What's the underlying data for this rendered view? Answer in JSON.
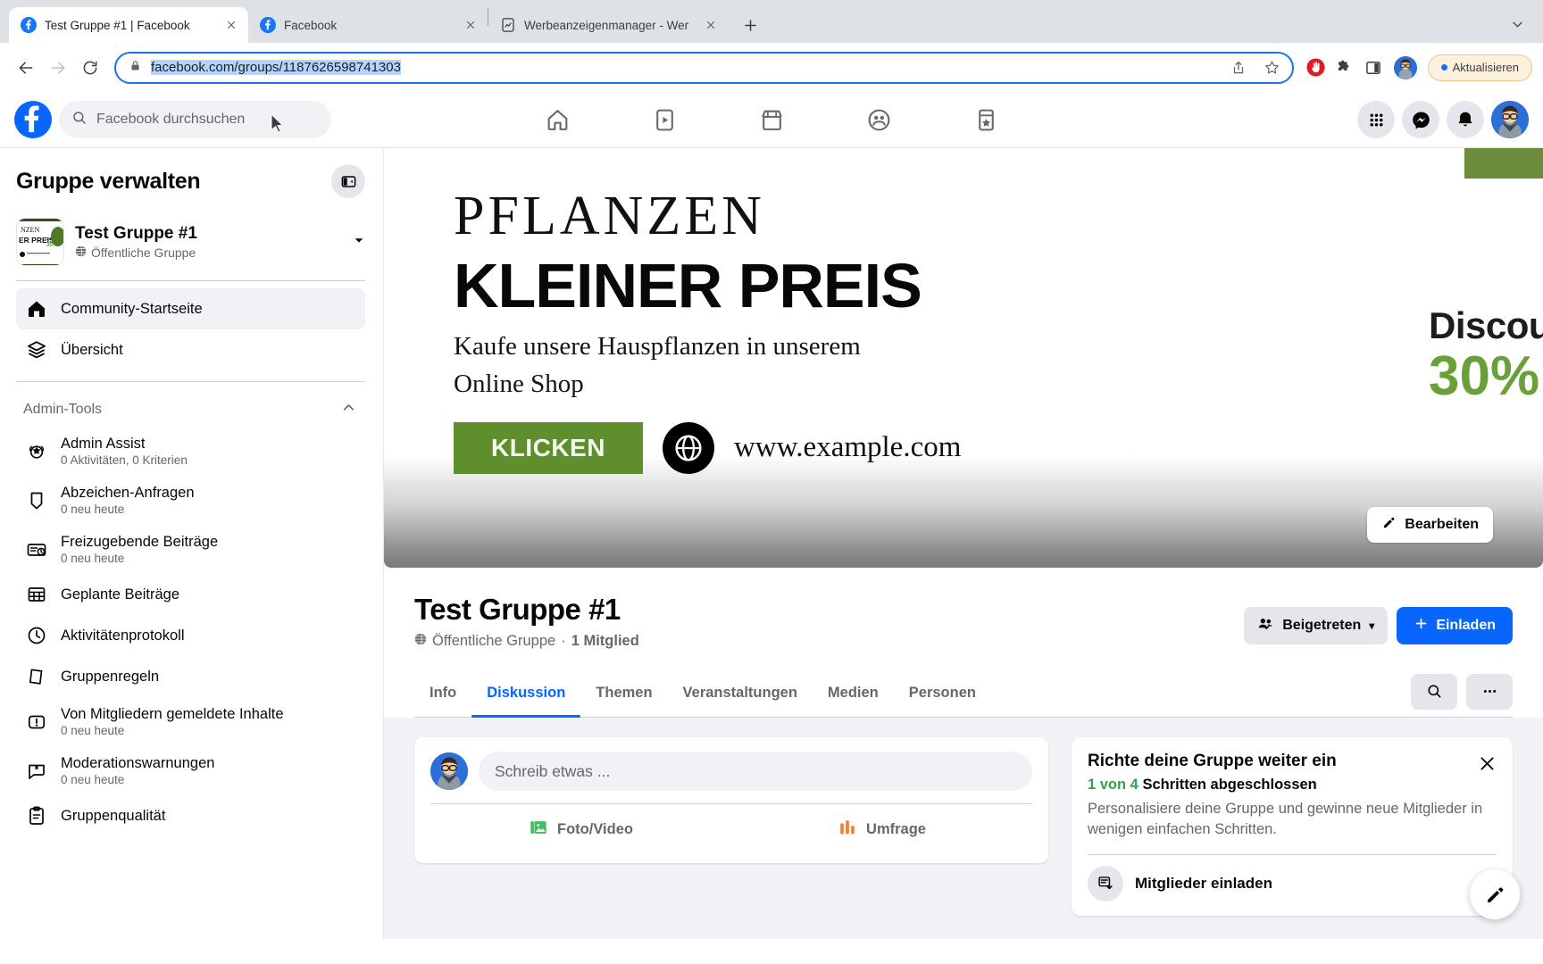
{
  "browser": {
    "tabs": [
      {
        "title": "Test Gruppe #1 | Facebook",
        "icon": "facebook-favicon",
        "active": true
      },
      {
        "title": "Facebook",
        "icon": "facebook-favicon",
        "active": false
      },
      {
        "title": "Werbeanzeigenmanager - Wer",
        "icon": "ads-manager-favicon",
        "active": false
      }
    ],
    "new_tab_label": "+",
    "window_chevron": "⌄",
    "nav": {
      "back": "←",
      "forward": "→",
      "reload": "↻"
    },
    "address": {
      "lock_icon": "lock-icon",
      "url": "facebook.com/groups/1187626598741303",
      "share_icon": "share-icon",
      "bookmark_icon": "star-icon"
    },
    "extensions": [
      "adblock-icon",
      "puzzle-icon",
      "sidepanel-icon"
    ],
    "update_button": "Aktualisieren"
  },
  "fb_header": {
    "logo": "facebook-logo",
    "search_placeholder": "Facebook durchsuchen",
    "nav": [
      {
        "name": "home",
        "icon": "home-icon"
      },
      {
        "name": "video",
        "icon": "video-icon"
      },
      {
        "name": "marketplace",
        "icon": "marketplace-icon"
      },
      {
        "name": "groups",
        "icon": "groups-icon"
      },
      {
        "name": "gaming",
        "icon": "gaming-icon"
      }
    ],
    "right": [
      {
        "name": "menu",
        "icon": "grid-menu-icon"
      },
      {
        "name": "messenger",
        "icon": "messenger-icon"
      },
      {
        "name": "notifications",
        "icon": "bell-icon"
      },
      {
        "name": "account",
        "icon": "avatar"
      }
    ]
  },
  "sidebar": {
    "title": "Gruppe verwalten",
    "collapse_icon": "collapse-panel-icon",
    "group": {
      "name": "Test Gruppe #1",
      "privacy": "Öffentliche Gruppe",
      "privacy_icon": "globe-icon",
      "caret": "▼"
    },
    "nav_items": [
      {
        "label": "Community-Startseite",
        "icon": "home-icon",
        "active": true
      },
      {
        "label": "Übersicht",
        "icon": "layers-icon",
        "active": false
      }
    ],
    "section": {
      "label": "Admin-Tools",
      "chevron": "chevron-up-icon"
    },
    "admin_items": [
      {
        "label": "Admin Assist",
        "sub": "0 Aktivitäten, 0 Kriterien",
        "icon": "admin-assist-icon"
      },
      {
        "label": "Abzeichen-Anfragen",
        "sub": "0 neu heute",
        "icon": "badge-icon"
      },
      {
        "label": "Freizugebende Beiträge",
        "sub": "0 neu heute",
        "icon": "pending-posts-icon"
      },
      {
        "label": "Geplante Beiträge",
        "sub": "",
        "icon": "calendar-icon"
      },
      {
        "label": "Aktivitätenprotokoll",
        "sub": "",
        "icon": "clock-icon"
      },
      {
        "label": "Gruppenregeln",
        "sub": "",
        "icon": "rules-icon"
      },
      {
        "label": "Von Mitgliedern gemeldete Inhalte",
        "sub": "0 neu heute",
        "icon": "report-icon"
      },
      {
        "label": "Moderationswarnungen",
        "sub": "0 neu heute",
        "icon": "moderation-alert-icon"
      },
      {
        "label": "Gruppenqualität",
        "sub": "",
        "icon": "quality-icon"
      }
    ]
  },
  "cover": {
    "headline_serif": "PFLANZEN",
    "headline_bold": "KLEINER PREIS",
    "subline": "Kaufe unsere Hauspflanzen in unserem\nOnline Shop",
    "cta_label": "KLICKEN",
    "globe_icon": "globe-icon",
    "website": "www.example.com",
    "discount_word": "Discount",
    "discount_value": "30%",
    "edit_button": "Bearbeiten",
    "edit_icon": "pencil-icon",
    "colors": {
      "cta_green": "#5f8f2c",
      "discount_green": "#6aa038"
    }
  },
  "group_header": {
    "name": "Test Gruppe #1",
    "privacy": "Öffentliche Gruppe",
    "privacy_icon": "globe-icon",
    "separator": "·",
    "members": "1 Mitglied",
    "joined_button": "Beigetreten",
    "joined_icon": "members-check-icon",
    "joined_caret": "▾",
    "invite_button": "Einladen",
    "invite_icon": "plus-icon",
    "tabs": [
      {
        "label": "Info",
        "active": false
      },
      {
        "label": "Diskussion",
        "active": true
      },
      {
        "label": "Themen",
        "active": false
      },
      {
        "label": "Veranstaltungen",
        "active": false
      },
      {
        "label": "Medien",
        "active": false
      },
      {
        "label": "Personen",
        "active": false
      }
    ],
    "search_icon": "search-icon",
    "more_icon": "more-horizontal-icon"
  },
  "composer": {
    "avatar": "avatar",
    "placeholder": "Schreib etwas ...",
    "actions": [
      {
        "label": "Foto/Video",
        "icon": "photo-video-icon",
        "color": "#45bd62"
      },
      {
        "label": "Umfrage",
        "icon": "poll-icon",
        "color": "#f3802d"
      }
    ]
  },
  "setup_card": {
    "title": "Richte deine Gruppe weiter ein",
    "steps_count": "1 von 4",
    "steps_suffix": "Schritten abgeschlossen",
    "description": "Personalisiere deine Gruppe und gewinne neue Mitglieder in wenigen einfachen Schritten.",
    "close_icon": "close-icon",
    "item_label": "Mitglieder einladen",
    "item_icon": "invite-members-icon"
  },
  "fab": {
    "icon": "compose-icon"
  },
  "accent_colors": {
    "fb_blue": "#0866ff",
    "chrome_blue": "#1a73e8",
    "green": "#31a24c"
  }
}
